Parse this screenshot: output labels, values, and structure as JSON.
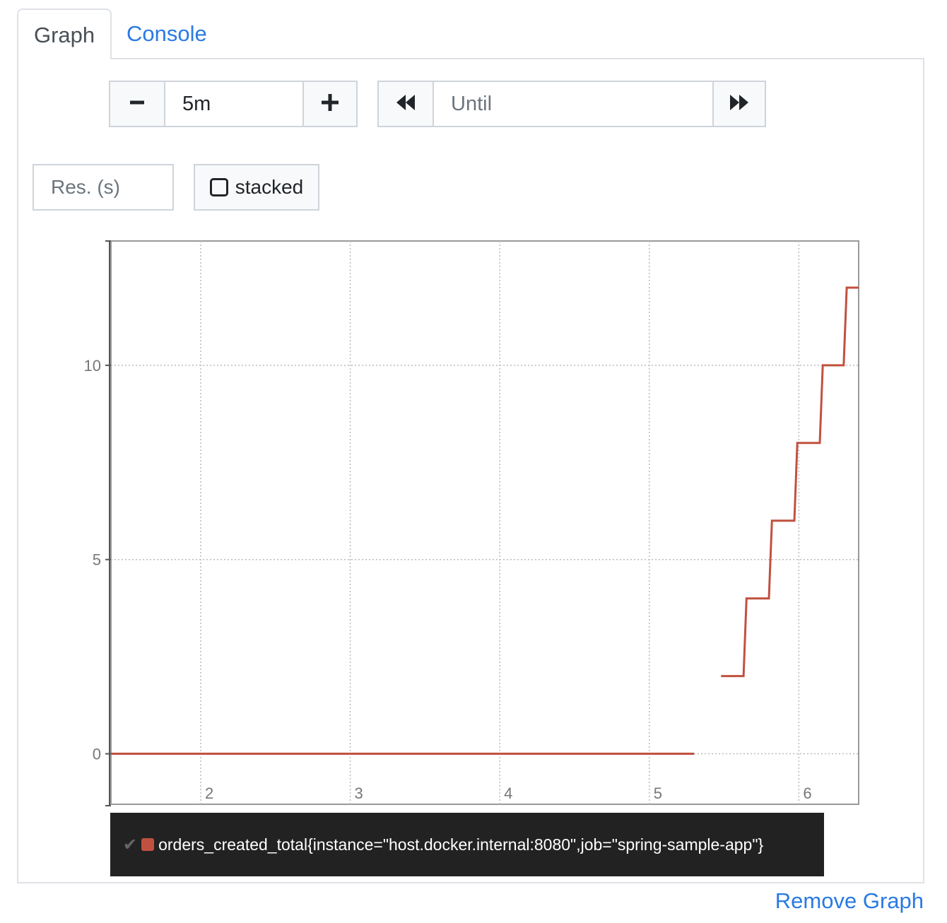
{
  "tabs": [
    {
      "label": "Graph",
      "active": true
    },
    {
      "label": "Console",
      "active": false
    }
  ],
  "controls": {
    "range": {
      "decrement_icon": "minus-icon",
      "value": "5m",
      "increment_icon": "plus-icon"
    },
    "until": {
      "back_icon": "fast-backward-icon",
      "placeholder": "Until",
      "forward_icon": "fast-forward-icon"
    },
    "resolution": {
      "placeholder": "Res. (s)"
    },
    "stacked": {
      "label": "stacked",
      "checked": false
    }
  },
  "chart_data": {
    "type": "line",
    "xlim": [
      1.4,
      6.4
    ],
    "ylim": [
      -1.3,
      13.2
    ],
    "x_ticks": [
      2,
      3,
      4,
      5,
      6
    ],
    "y_ticks": [
      0,
      5,
      10
    ],
    "grid": true,
    "series": [
      {
        "name": "orders_created_total{instance=\"host.docker.internal:8080\",job=\"spring-sample-app\"}",
        "color": "#c1513f",
        "segments": [
          [
            [
              1.4,
              0
            ],
            [
              5.3,
              0
            ]
          ],
          [
            [
              5.48,
              2
            ],
            [
              5.63,
              2
            ],
            [
              5.65,
              4
            ],
            [
              5.8,
              4
            ],
            [
              5.82,
              6
            ],
            [
              5.97,
              6
            ],
            [
              5.99,
              8
            ],
            [
              6.14,
              8
            ],
            [
              6.16,
              10
            ],
            [
              6.3,
              10
            ],
            [
              6.32,
              12
            ],
            [
              6.4,
              12
            ]
          ]
        ]
      }
    ]
  },
  "legend": {
    "check_icon": "check-icon",
    "label": "orders_created_total{instance=\"host.docker.internal:8080\",job=\"spring-sample-app\"}"
  },
  "actions": {
    "remove_label": "Remove Graph"
  }
}
